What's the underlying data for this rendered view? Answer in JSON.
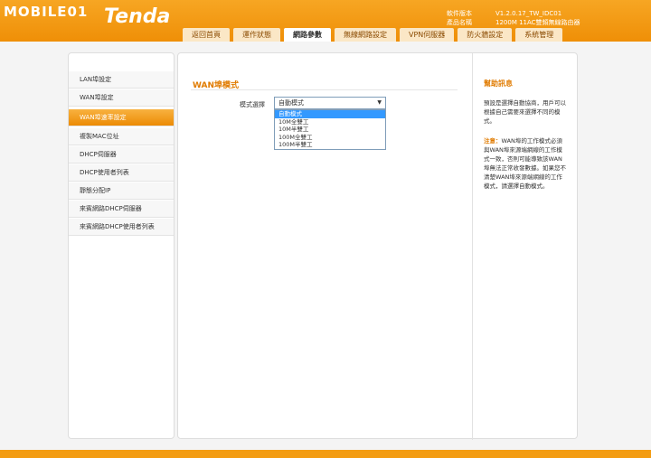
{
  "header": {
    "watermark": "MOBILE01",
    "brand": "Tenda",
    "info_labels": [
      "軟件版本",
      "產品名稱"
    ],
    "info_values": [
      "V1.2.0.17_TW_IDC01",
      "1200M 11AC雙頻無線路由器"
    ]
  },
  "tabs": [
    {
      "label": "返回首頁",
      "active": false
    },
    {
      "label": "運作狀態",
      "active": false
    },
    {
      "label": "網路參數",
      "active": true
    },
    {
      "label": "無線網路設定",
      "active": false
    },
    {
      "label": "VPN伺服器",
      "active": false
    },
    {
      "label": "防火牆設定",
      "active": false
    },
    {
      "label": "系統管理",
      "active": false
    }
  ],
  "sidebar": {
    "items": [
      {
        "label": "LAN埠設定",
        "active": false
      },
      {
        "label": "WAN埠設定",
        "active": false
      },
      {
        "label": "WAN埠速率設定",
        "active": true
      },
      {
        "label": "複製MAC位址",
        "active": false
      },
      {
        "label": "DHCP伺服器",
        "active": false
      },
      {
        "label": "DHCP使用者列表",
        "active": false
      },
      {
        "label": "靜態分配IP",
        "active": false
      },
      {
        "label": "來賓網路DHCP伺服器",
        "active": false
      },
      {
        "label": "來賓網路DHCP使用者列表",
        "active": false
      }
    ]
  },
  "main": {
    "section_title": "WAN埠模式",
    "field_label": "模式選擇",
    "select_value": "自動模式",
    "options": [
      "自動模式",
      "10M全雙工",
      "10M半雙工",
      "100M全雙工",
      "100M半雙工"
    ],
    "selected_index": 0
  },
  "help": {
    "title": "幫助訊息",
    "text": "預設是選擇自動協商，用戶可以根據自己需要來選擇不同的模式。",
    "note_label": "注意：",
    "note_text": "WAN埠的工作模式必須與WAN埠來源端網線的工作模式一致，否則可能導致該WAN埠無法正常收發數據。如果您不清楚WAN埠來源端網線的工作模式，請選擇自動模式。"
  },
  "colors": {
    "accent": "#f39c12",
    "title": "#e07b00",
    "selected": "#3399ff"
  }
}
